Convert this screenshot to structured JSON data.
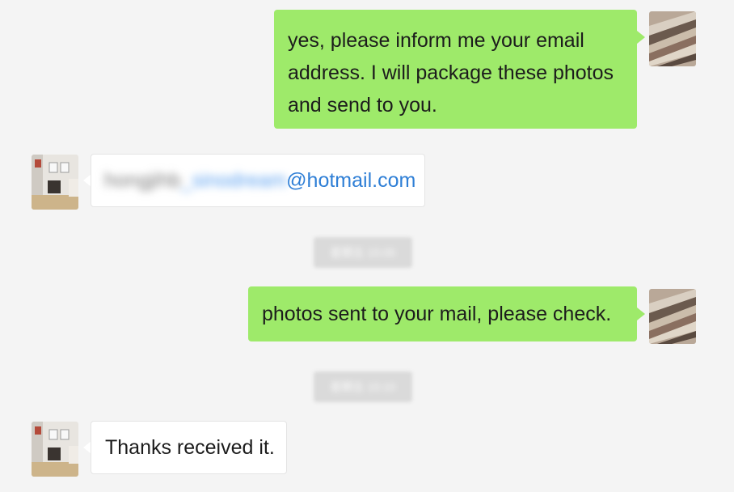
{
  "chat": {
    "messages": [
      {
        "sender": "me",
        "lines": [
          "yes, please inform me your email",
          "address. I will package these photos",
          "and send to you."
        ]
      },
      {
        "sender": "them",
        "email_user_blurred": "hongjihb",
        "email_mid_blurred": "_sinodream",
        "email_domain": "@hotmail.com"
      },
      {
        "sender": "system",
        "timestamp": "星期五 15:05"
      },
      {
        "sender": "me",
        "text": "photos sent to your mail, please check."
      },
      {
        "sender": "system",
        "timestamp": "星期五 15:10"
      },
      {
        "sender": "them",
        "text": "Thanks received it."
      }
    ]
  },
  "avatars": {
    "me": "fabric-stripes-avatar",
    "them": "room-interior-avatar"
  },
  "colors": {
    "background": "#f4f4f4",
    "my_bubble": "#9eea6a",
    "their_bubble": "#ffffff",
    "link_blue": "#2f7fd6"
  }
}
